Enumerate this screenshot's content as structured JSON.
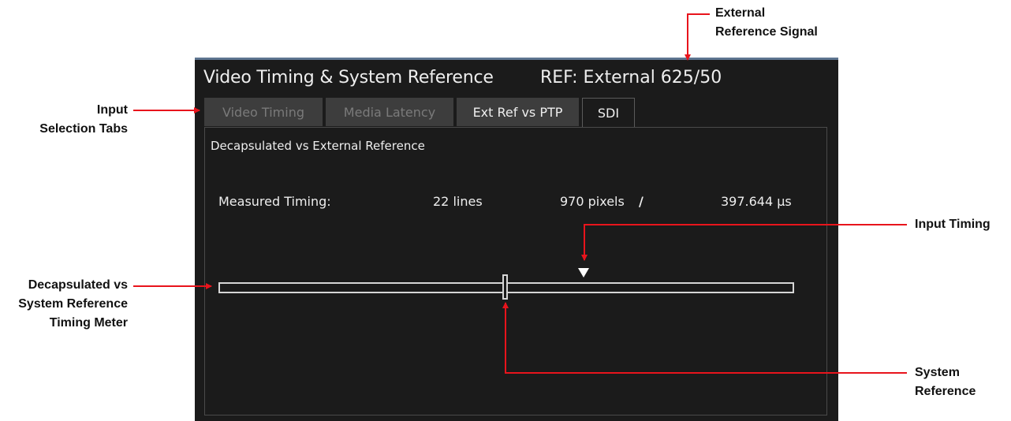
{
  "panel": {
    "title": "Video Timing & System Reference",
    "ref_status": "REF: External 625/50"
  },
  "tabs": [
    {
      "label": "Video Timing",
      "state": "dimmed"
    },
    {
      "label": "Media Latency",
      "state": "dimmed"
    },
    {
      "label": "Ext Ref vs PTP",
      "state": "normal"
    },
    {
      "label": "SDI",
      "state": "selected"
    }
  ],
  "content": {
    "title": "Decapsulated vs External Reference",
    "measurement": {
      "label": "Measured Timing:",
      "lines": "22 lines",
      "pixels": "970 pixels",
      "separator": "/",
      "time": "397.644 µs"
    },
    "meter": {
      "system_reference_fraction": 0.5,
      "input_timing_fraction": 0.636
    }
  },
  "callouts": {
    "external_reference": [
      "External",
      "Reference Signal"
    ],
    "input_selection_tabs": [
      "Input",
      "Selection Tabs"
    ],
    "input_timing": [
      "Input Timing"
    ],
    "timing_meter": [
      "Decapsulated vs",
      "System Reference",
      "Timing Meter"
    ],
    "system_reference": [
      "System",
      "Reference"
    ]
  },
  "colors": {
    "panel_background": "#1b1b1b",
    "panel_top_border": "#5e7590",
    "arrow_red": "#e8141c",
    "dimmed_tab_text": "#7a7a7a"
  }
}
